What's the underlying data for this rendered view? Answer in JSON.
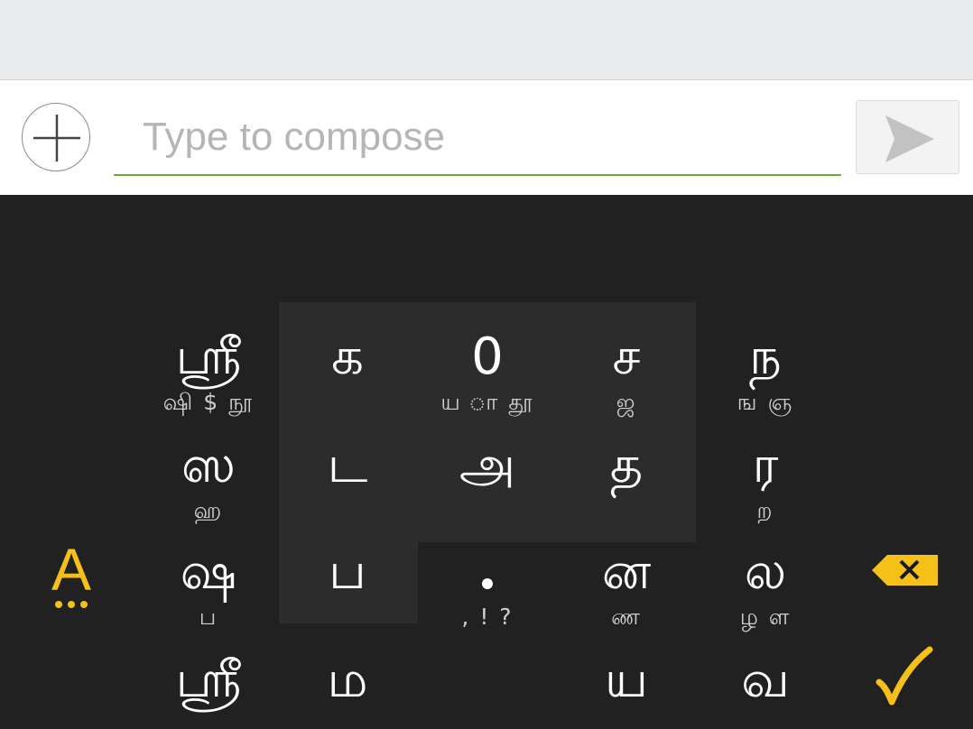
{
  "compose": {
    "placeholder": "Type to compose"
  },
  "icons": {
    "add": "plus-circle-icon",
    "send": "send-arrow-icon",
    "backspace": "backspace-icon",
    "done": "checkmark-icon",
    "language": "language-switch-icon"
  },
  "colors": {
    "keyboard_bg": "#212121",
    "highlight_bg": "#2c2c2c",
    "accent_yellow": "#f6c01a",
    "input_underline": "#6aab33"
  },
  "keyboard": {
    "language_key": "A",
    "rows": [
      [
        {
          "main": "ஸ்ரீ",
          "sub": "ஷி $ நூ"
        },
        {
          "main": "க",
          "sub": ""
        },
        {
          "main": "0",
          "sub": "ய ா தூ"
        },
        {
          "main": "ச",
          "sub": "ஜ"
        },
        {
          "main": "ந",
          "sub": "ங ஞ"
        }
      ],
      [
        {
          "main": "ஸ",
          "sub": "ஹ"
        },
        {
          "main": "ட",
          "sub": ""
        },
        {
          "main": "அ",
          "sub": ""
        },
        {
          "main": "த",
          "sub": ""
        },
        {
          "main": "ர",
          "sub": "ற"
        }
      ],
      [
        {
          "main": "ஷ",
          "sub": "ப"
        },
        {
          "main": "ப",
          "sub": ""
        },
        {
          "main": ".",
          "sub": ",  !  ?"
        },
        {
          "main": "ன",
          "sub": "ண"
        },
        {
          "main": "ல",
          "sub": "ழ ள"
        }
      ],
      [
        {
          "main": "ஸ்ரீ",
          "sub": ""
        },
        {
          "main": "ம",
          "sub": ""
        },
        {
          "main": "",
          "sub": ""
        },
        {
          "main": "ய",
          "sub": ""
        },
        {
          "main": "வ",
          "sub": ""
        }
      ]
    ]
  }
}
